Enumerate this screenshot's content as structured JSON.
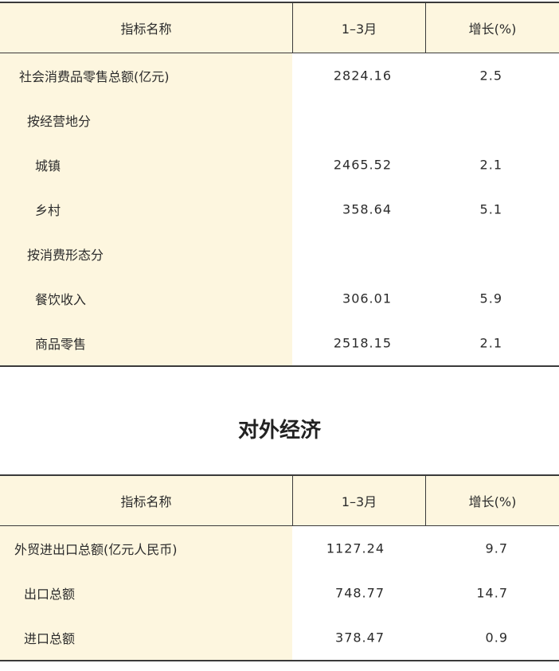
{
  "retail": {
    "header": {
      "name": "指标名称",
      "period": "1–3月",
      "growth": "增长(%)"
    },
    "rows": [
      {
        "name": "社会消费品零售总额(亿元)",
        "value": "2824.16",
        "growth": "2.5"
      },
      {
        "name": "按经营地分",
        "value": "",
        "growth": ""
      },
      {
        "name": "城镇",
        "value": "2465.52",
        "growth": "2.1"
      },
      {
        "name": "乡村",
        "value": "358.64",
        "growth": "5.1"
      },
      {
        "name": "按消费形态分",
        "value": "",
        "growth": ""
      },
      {
        "name": "餐饮收入",
        "value": "306.01",
        "growth": "5.9"
      },
      {
        "name": "商品零售",
        "value": "2518.15",
        "growth": "2.1"
      }
    ]
  },
  "section_title": "对外经济",
  "trade": {
    "header": {
      "name": "指标名称",
      "period": "1–3月",
      "growth": "增长(%)"
    },
    "rows": [
      {
        "name": "外贸进出口总额(亿元人民币)",
        "value": "1127.24",
        "growth": "9.7"
      },
      {
        "name": "出口总额",
        "value": "748.77",
        "growth": "14.7"
      },
      {
        "name": "进口总额",
        "value": "378.47",
        "growth": "0.9"
      }
    ]
  }
}
